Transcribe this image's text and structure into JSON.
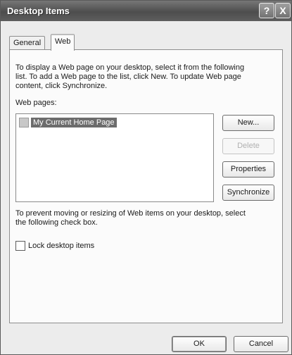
{
  "window": {
    "title": "Desktop Items",
    "help_icon": "?",
    "close_icon": "X"
  },
  "tabs": [
    {
      "label": "General",
      "active": false
    },
    {
      "label": "Web",
      "active": true
    }
  ],
  "web_tab": {
    "description_lines": [
      "To display a Web page on your desktop, select it from the following",
      "list. To add a Web page to the list, click New.  To update Web page",
      "content, click Synchronize."
    ],
    "web_pages_label": "Web pages:",
    "web_pages": [
      {
        "label": "My Current Home Page",
        "checked": false,
        "selected": true
      }
    ],
    "buttons": {
      "new": "New...",
      "delete": "Delete",
      "properties": "Properties",
      "synchronize": "Synchronize"
    },
    "lock_description_lines": [
      "To prevent moving or resizing of Web items on your desktop, select",
      "the following check box."
    ],
    "lock_label": "Lock desktop items",
    "lock_checked": false
  },
  "footer": {
    "ok": "OK",
    "cancel": "Cancel"
  }
}
